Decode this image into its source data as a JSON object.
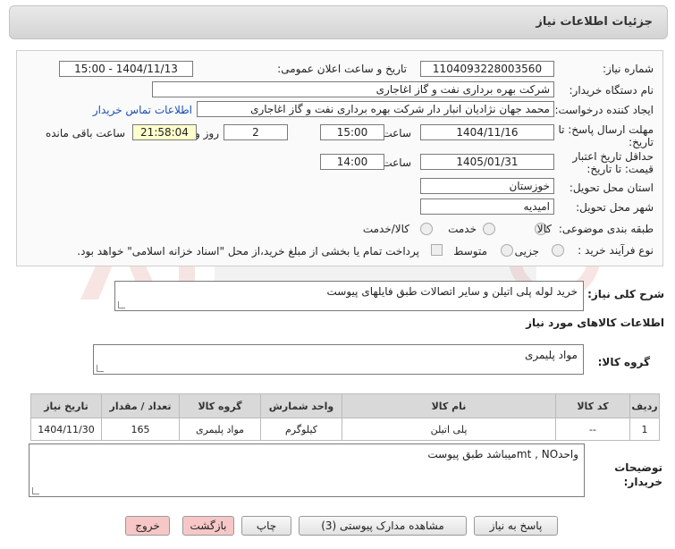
{
  "header": {
    "title": "جزئیات اطلاعات نیاز"
  },
  "form": {
    "need_number_label": "شماره نیاز:",
    "need_number": "1104093228003560",
    "announce_label": "تاریخ و ساعت اعلان عمومی:",
    "announce_value": "1404/11/13 - 15:00",
    "buyer_org_label": "نام دستگاه خریدار:",
    "buyer_org": "شرکت بهره برداری نفت و گاز اغاجاری",
    "creator_label": "ایجاد کننده درخواست:",
    "creator": "محمد جهان نژادیان انبار دار شرکت بهره برداری نفت و گاز اغاجاری",
    "contact_link": "اطلاعات تماس خریدار",
    "deadline_label_1": "مهلت ارسال پاسخ: تا",
    "deadline_label_2": "تاریخ:",
    "deadline_date": "1404/11/16",
    "time_label": "ساعت",
    "deadline_time": "15:00",
    "days_value": "2",
    "days_label": "روز و",
    "remaining_time": "21:58:04",
    "remaining_label": "ساعت باقی مانده",
    "validity_label_1": "حداقل تاریخ اعتبار",
    "validity_label_2": "قیمت: تا تاریخ:",
    "validity_date": "1405/01/31",
    "validity_time_label": "ساعت",
    "validity_time": "14:00",
    "province_label": "استان محل تحویل:",
    "province": "خوزستان",
    "city_label": "شهر محل تحویل:",
    "city": "امیدیه",
    "category_label": "طبقه بندی موضوعی:",
    "category_options": [
      "کالا",
      "خدمت",
      "کالا/خدمت"
    ],
    "process_label": "نوع فرآیند خرید :",
    "process_options": [
      "جزیی",
      "متوسط"
    ],
    "payment_note": "پرداخت تمام یا بخشی از مبلغ خرید،از محل \"اسناد خزانه اسلامی\" خواهد بود."
  },
  "summary": {
    "label": "شرح کلی نیاز:",
    "value": "خرید لوله پلی اتیلن و سایر اتصالات طبق فایلهای پیوست"
  },
  "goods_info": {
    "title": "اطلاعات کالاهای مورد نیاز",
    "group_label": "گروه کالا:",
    "group_value": "مواد پلیمری"
  },
  "table": {
    "headers": [
      "ردیف",
      "کد کالا",
      "نام کالا",
      "واحد شمارش",
      "گروه کالا",
      "تعداد / مقدار",
      "تاریخ نیاز"
    ],
    "rows": [
      [
        "1",
        "--",
        "پلی اتیلن",
        "کیلوگرم",
        "مواد پلیمری",
        "165",
        "1404/11/30"
      ]
    ]
  },
  "buyer_notes": {
    "label_1": "توضیحات",
    "label_2": "خریدار:",
    "value": "واحدmt , NOمیباشد طبق پیوست"
  },
  "buttons": {
    "reply": "پاسخ به نیاز",
    "view_docs": "مشاهده مدارک پیوستی (3)",
    "print": "چاپ",
    "back": "بازگشت",
    "exit": "خروج"
  }
}
